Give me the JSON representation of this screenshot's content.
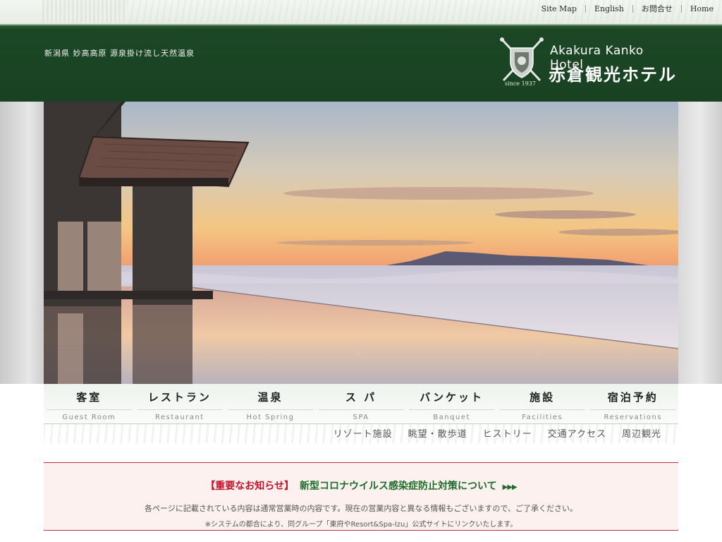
{
  "top_nav": {
    "items": [
      "Site Map",
      "English",
      "お問合せ",
      "Home"
    ]
  },
  "header": {
    "tagline": "新潟県 妙高高原 源泉掛け流し天然温泉",
    "logo_en": "Akakura Kanko Hotel",
    "logo_jp": "赤倉観光ホテル",
    "logo_since": "since 1937"
  },
  "main_nav": [
    {
      "jp": "客室",
      "en": "Guest Room"
    },
    {
      "jp": "レストラン",
      "en": "Restaurant"
    },
    {
      "jp": "温泉",
      "en": "Hot Spring"
    },
    {
      "jp": "ス パ",
      "en": "SPA"
    },
    {
      "jp": "バンケット",
      "en": "Banquet"
    },
    {
      "jp": "施設",
      "en": "Facilities"
    },
    {
      "jp": "宿泊予約",
      "en": "Reservations"
    }
  ],
  "sub_nav": [
    "リゾート施設",
    "眺望・散歩道",
    "ヒストリー",
    "交通アクセス",
    "周辺観光"
  ],
  "notice": {
    "label": "【重要なお知らせ】",
    "title": "新型コロナウイルス感染症防止対策について",
    "arrow": "▶▶▶",
    "line1": "各ページに記載されている内容は通常営業時の内容です。現在の営業内容と異なる情報もございますので、ご了承ください。",
    "line2": "※システムの都合により、同グループ「東府やResort&Spa-Izu」公式サイトにリンクいたします。"
  },
  "colors": {
    "header_green": "#1c4726",
    "notice_red": "#c4122a",
    "notice_green": "#1f6b2a"
  }
}
